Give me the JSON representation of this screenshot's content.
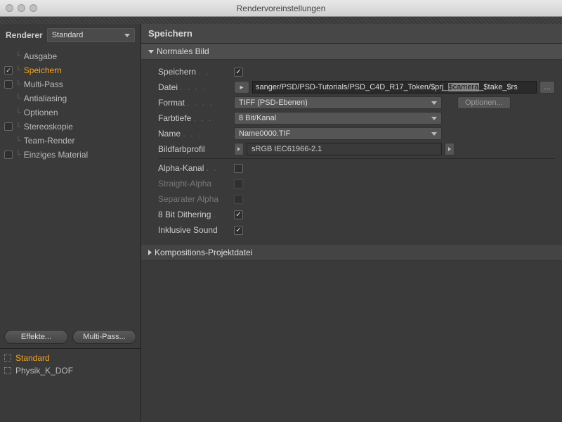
{
  "window": {
    "title": "Rendervoreinstellungen"
  },
  "renderer": {
    "label": "Renderer",
    "value": "Standard"
  },
  "sidebar": {
    "items": [
      {
        "label": "Ausgabe",
        "checked": "blank"
      },
      {
        "label": "Speichern",
        "checked": "on",
        "active": true
      },
      {
        "label": "Multi-Pass",
        "checked": "off"
      },
      {
        "label": "Antialiasing",
        "checked": "blank"
      },
      {
        "label": "Optionen",
        "checked": "blank"
      },
      {
        "label": "Stereoskopie",
        "checked": "off"
      },
      {
        "label": "Team-Render",
        "checked": "blank"
      },
      {
        "label": "Einziges Material",
        "checked": "off"
      }
    ],
    "buttons": {
      "effects": "Effekte...",
      "multipass": "Multi-Pass..."
    },
    "presets": [
      {
        "label": "Standard",
        "active": true
      },
      {
        "label": "Physik_K_DOF",
        "active": false
      }
    ]
  },
  "panel": {
    "title": "Speichern",
    "section_normal": "Normales Bild",
    "section_comp": "Kompositions-Projektdatei",
    "fields": {
      "save": {
        "label": "Speichern",
        "checked": true
      },
      "file": {
        "label": "Datei",
        "pre": "sanger/PSD/PSD-Tutorials/PSD_C4D_R17_Token/$prj_",
        "sel": "$camera",
        "post": "_$take_$rs"
      },
      "format": {
        "label": "Format",
        "value": "TIFF (PSD-Ebenen)",
        "options_btn": "Optionen..."
      },
      "depth": {
        "label": "Farbtiefe",
        "value": "8 Bit/Kanal"
      },
      "name": {
        "label": "Name",
        "value": "Name0000.TIF"
      },
      "profile": {
        "label": "Bildfarbprofil",
        "value": "sRGB IEC61966-2.1"
      },
      "alpha": {
        "label": "Alpha-Kanal",
        "checked": false
      },
      "straight": {
        "label": "Straight-Alpha",
        "checked": false,
        "dim": true
      },
      "separate": {
        "label": "Separater Alpha",
        "checked": false,
        "dim": true
      },
      "dither": {
        "label": "8 Bit Dithering",
        "checked": true
      },
      "sound": {
        "label": "Inklusive Sound",
        "checked": true
      }
    }
  }
}
